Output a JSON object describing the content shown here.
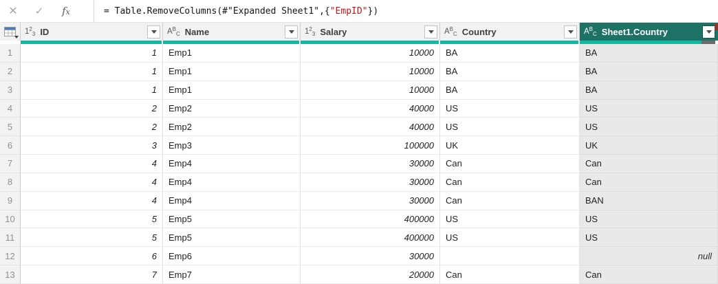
{
  "formula_bar": {
    "cancel_glyph": "✕",
    "commit_glyph": "✓",
    "fx_label": "fx",
    "segments": [
      {
        "text": "= Table.RemoveColumns(#\"Expanded Sheet1\",{",
        "kind": "code"
      },
      {
        "text": "\"EmpID\"",
        "kind": "string"
      },
      {
        "text": "})",
        "kind": "code"
      }
    ]
  },
  "colors": {
    "selected_header_bg": "#1e7265",
    "quality_bar_teal": "#0ebaa4",
    "quality_bar_empty_gray": "#6b6b6b",
    "string_literal_red": "#b21b1b",
    "select_all_icon_blue": "#4a7ebb"
  },
  "icons": {
    "number-123-icon": {
      "base": "1",
      "sup": "2",
      "sub": "3"
    },
    "text-abc-icon": {
      "base": "A",
      "sup": "B",
      "sub": "C"
    }
  },
  "table": {
    "columns": [
      {
        "key": "id",
        "label": "ID",
        "type_icon": "number-123-icon",
        "numeric": true,
        "selected": false,
        "has_empty": false
      },
      {
        "key": "name",
        "label": "Name",
        "type_icon": "text-abc-icon",
        "numeric": false,
        "selected": false,
        "has_empty": false
      },
      {
        "key": "salary",
        "label": "Salary",
        "type_icon": "number-123-icon",
        "numeric": true,
        "selected": false,
        "has_empty": false
      },
      {
        "key": "country",
        "label": "Country",
        "type_icon": "text-abc-icon",
        "numeric": false,
        "selected": false,
        "has_empty": false
      },
      {
        "key": "sheet1_country",
        "label": "Sheet1.Country",
        "type_icon": "text-abc-icon",
        "numeric": false,
        "selected": true,
        "has_empty": true
      }
    ],
    "rows": [
      {
        "n": "1",
        "id": "1",
        "name": "Emp1",
        "salary": "10000",
        "country": "BA",
        "sheet1_country": "BA"
      },
      {
        "n": "2",
        "id": "1",
        "name": "Emp1",
        "salary": "10000",
        "country": "BA",
        "sheet1_country": "BA"
      },
      {
        "n": "3",
        "id": "1",
        "name": "Emp1",
        "salary": "10000",
        "country": "BA",
        "sheet1_country": "BA"
      },
      {
        "n": "4",
        "id": "2",
        "name": "Emp2",
        "salary": "40000",
        "country": "US",
        "sheet1_country": "US"
      },
      {
        "n": "5",
        "id": "2",
        "name": "Emp2",
        "salary": "40000",
        "country": "US",
        "sheet1_country": "US"
      },
      {
        "n": "6",
        "id": "3",
        "name": "Emp3",
        "salary": "100000",
        "country": "UK",
        "sheet1_country": "UK"
      },
      {
        "n": "7",
        "id": "4",
        "name": "Emp4",
        "salary": "30000",
        "country": "Can",
        "sheet1_country": "Can"
      },
      {
        "n": "8",
        "id": "4",
        "name": "Emp4",
        "salary": "30000",
        "country": "Can",
        "sheet1_country": "Can"
      },
      {
        "n": "9",
        "id": "4",
        "name": "Emp4",
        "salary": "30000",
        "country": "Can",
        "sheet1_country": "BAN"
      },
      {
        "n": "10",
        "id": "5",
        "name": "Emp5",
        "salary": "400000",
        "country": "US",
        "sheet1_country": "US"
      },
      {
        "n": "11",
        "id": "5",
        "name": "Emp5",
        "salary": "400000",
        "country": "US",
        "sheet1_country": "US"
      },
      {
        "n": "12",
        "id": "6",
        "name": "Emp6",
        "salary": "30000",
        "country": "",
        "sheet1_country": "null",
        "sheet1_country_is_null": true
      },
      {
        "n": "13",
        "id": "7",
        "name": "Emp7",
        "salary": "20000",
        "country": "Can",
        "sheet1_country": "Can"
      }
    ]
  }
}
